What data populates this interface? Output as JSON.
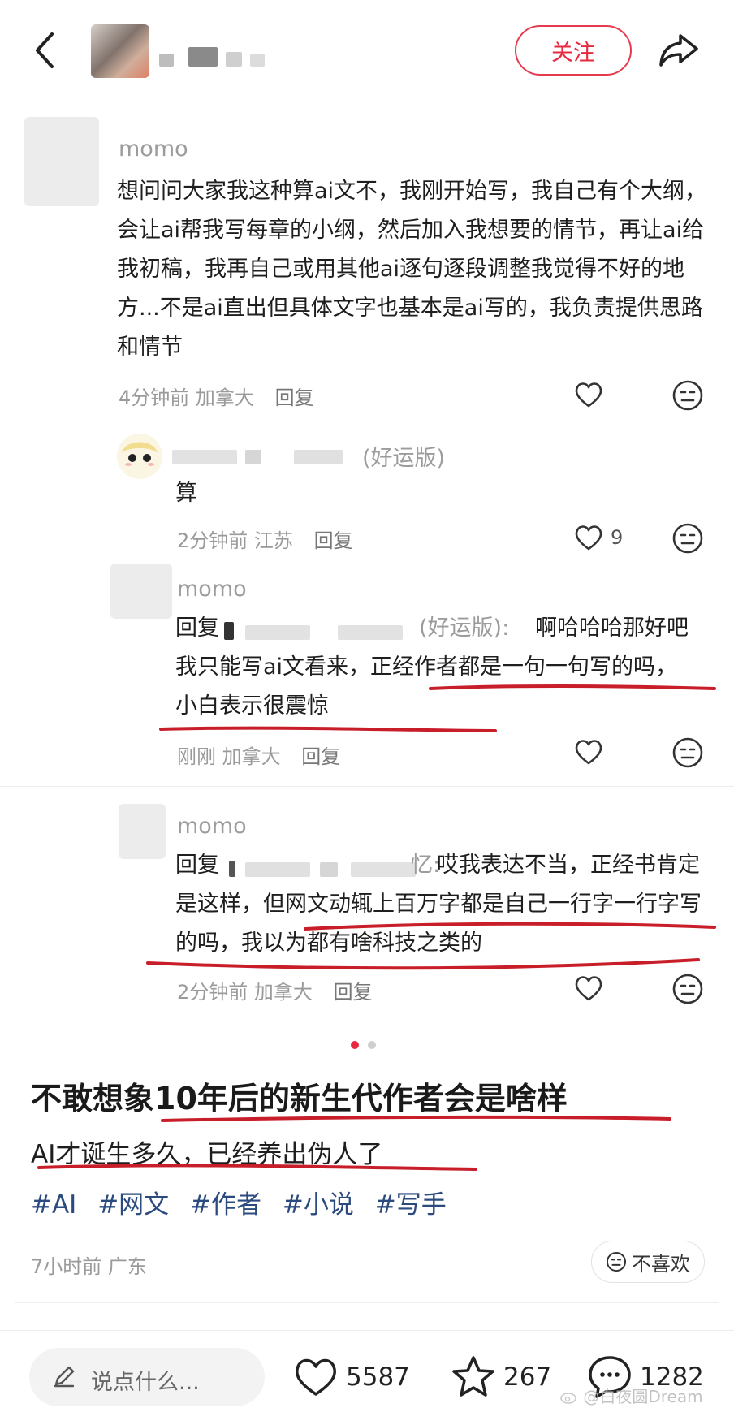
{
  "header": {
    "follow_label": "关注"
  },
  "comments": [
    {
      "name": "momo",
      "text": "想问问大家我这种算ai文不，我刚开始写，我自己有个大纲，会让ai帮我写每章的小纲，然后加入我想要的情节，再让ai给我初稿，我再自己或用其他ai逐句逐段调整我觉得不好的地方...不是ai直出但具体文字也基本是ai写的，我负责提供思路和情节",
      "time": "4分钟前",
      "location": "加拿大",
      "reply_label": "回复"
    },
    {
      "name_suffix": "(好运版)",
      "text": "算",
      "time": "2分钟前",
      "location": "江苏",
      "reply_label": "回复",
      "like_count": "9"
    },
    {
      "name": "momo",
      "reply_prefix": "回复",
      "reply_target_suffix": "(好运版):",
      "text": "啊哈哈哈那好吧我只能写ai文看来，正经作者都是一句一句写的吗，小白表示很震惊",
      "time": "刚刚",
      "location": "加拿大",
      "reply_label": "回复"
    },
    {
      "name": "momo",
      "reply_prefix": "回复",
      "reply_target_suffix": "忆:",
      "text": "哎我表达不当，正经书肯定是这样，但网文动辄上百万字都是自己一行字一行字写的吗，我以为都有啥科技之类的",
      "time": "2分钟前",
      "location": "加拿大",
      "reply_label": "回复"
    }
  ],
  "post": {
    "title": "不敢想象10年后的新生代作者会是啥样",
    "body": "AI才诞生多久，已经养出伪人了",
    "tags": [
      "#AI",
      "#网文",
      "#作者",
      "#小说",
      "#写手"
    ],
    "time": "7小时前",
    "location": "广东",
    "dislike_label": "不喜欢"
  },
  "bottom_bar": {
    "input_placeholder": "说点什么...",
    "likes": "5587",
    "stars": "267",
    "comments": "1282"
  },
  "watermark": "@白夜圆Dream",
  "colors": {
    "accent": "#e8283f",
    "tag": "#2b4a7e",
    "underline": "#c81e2a"
  }
}
